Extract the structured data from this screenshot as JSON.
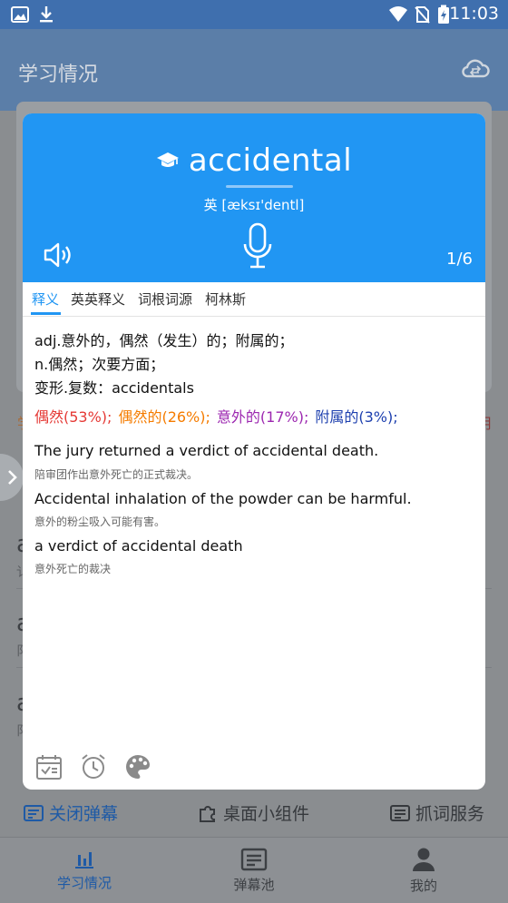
{
  "status_bar": {
    "time": "11:03"
  },
  "app": {
    "title": "学习情况"
  },
  "dialog": {
    "word": "accidental",
    "phonetic": "英 [æksɪ'dentl]",
    "counter": "1/6",
    "tabs": [
      {
        "label": "释义",
        "active": true
      },
      {
        "label": "英英释义"
      },
      {
        "label": "词根词源"
      },
      {
        "label": "柯林斯"
      }
    ],
    "definitions": [
      "adj.意外的，偶然（发生）的；附属的；",
      "n.偶然；次要方面；",
      "变形.复数：accidentals"
    ],
    "frequencies": [
      {
        "text": "偶然(53%);",
        "color": "#e53935"
      },
      {
        "text": "偶然的(26%);",
        "color": "#f57c00"
      },
      {
        "text": "意外的(17%);",
        "color": "#9c27b0"
      },
      {
        "text": "附属的(3%);",
        "color": "#1e40af"
      }
    ],
    "examples": [
      {
        "en": "The jury returned a verdict of accidental death.",
        "zh": "陪审团作出意外死亡的正式裁决。"
      },
      {
        "en": "Accidental inhalation of the powder can be harmful.",
        "zh": "意外的粉尘吸入可能有害。"
      },
      {
        "en": "a verdict of accidental death",
        "zh": "意外死亡的裁决"
      }
    ]
  },
  "background": {
    "edge_left": "学",
    "edge_right": "用",
    "list_letters": [
      "a",
      "a",
      "a"
    ],
    "list_subs": [
      "讠",
      "阝",
      "阝"
    ]
  },
  "actions": {
    "close_danmaku": "关闭弹幕",
    "desktop_widget": "桌面小组件",
    "word_service": "抓词服务"
  },
  "nav": {
    "study": "学习情况",
    "danmaku_pool": "弹幕池",
    "mine": "我的"
  },
  "colors": {
    "accent": "#2196f3",
    "nav_active": "#1e5aa6"
  }
}
